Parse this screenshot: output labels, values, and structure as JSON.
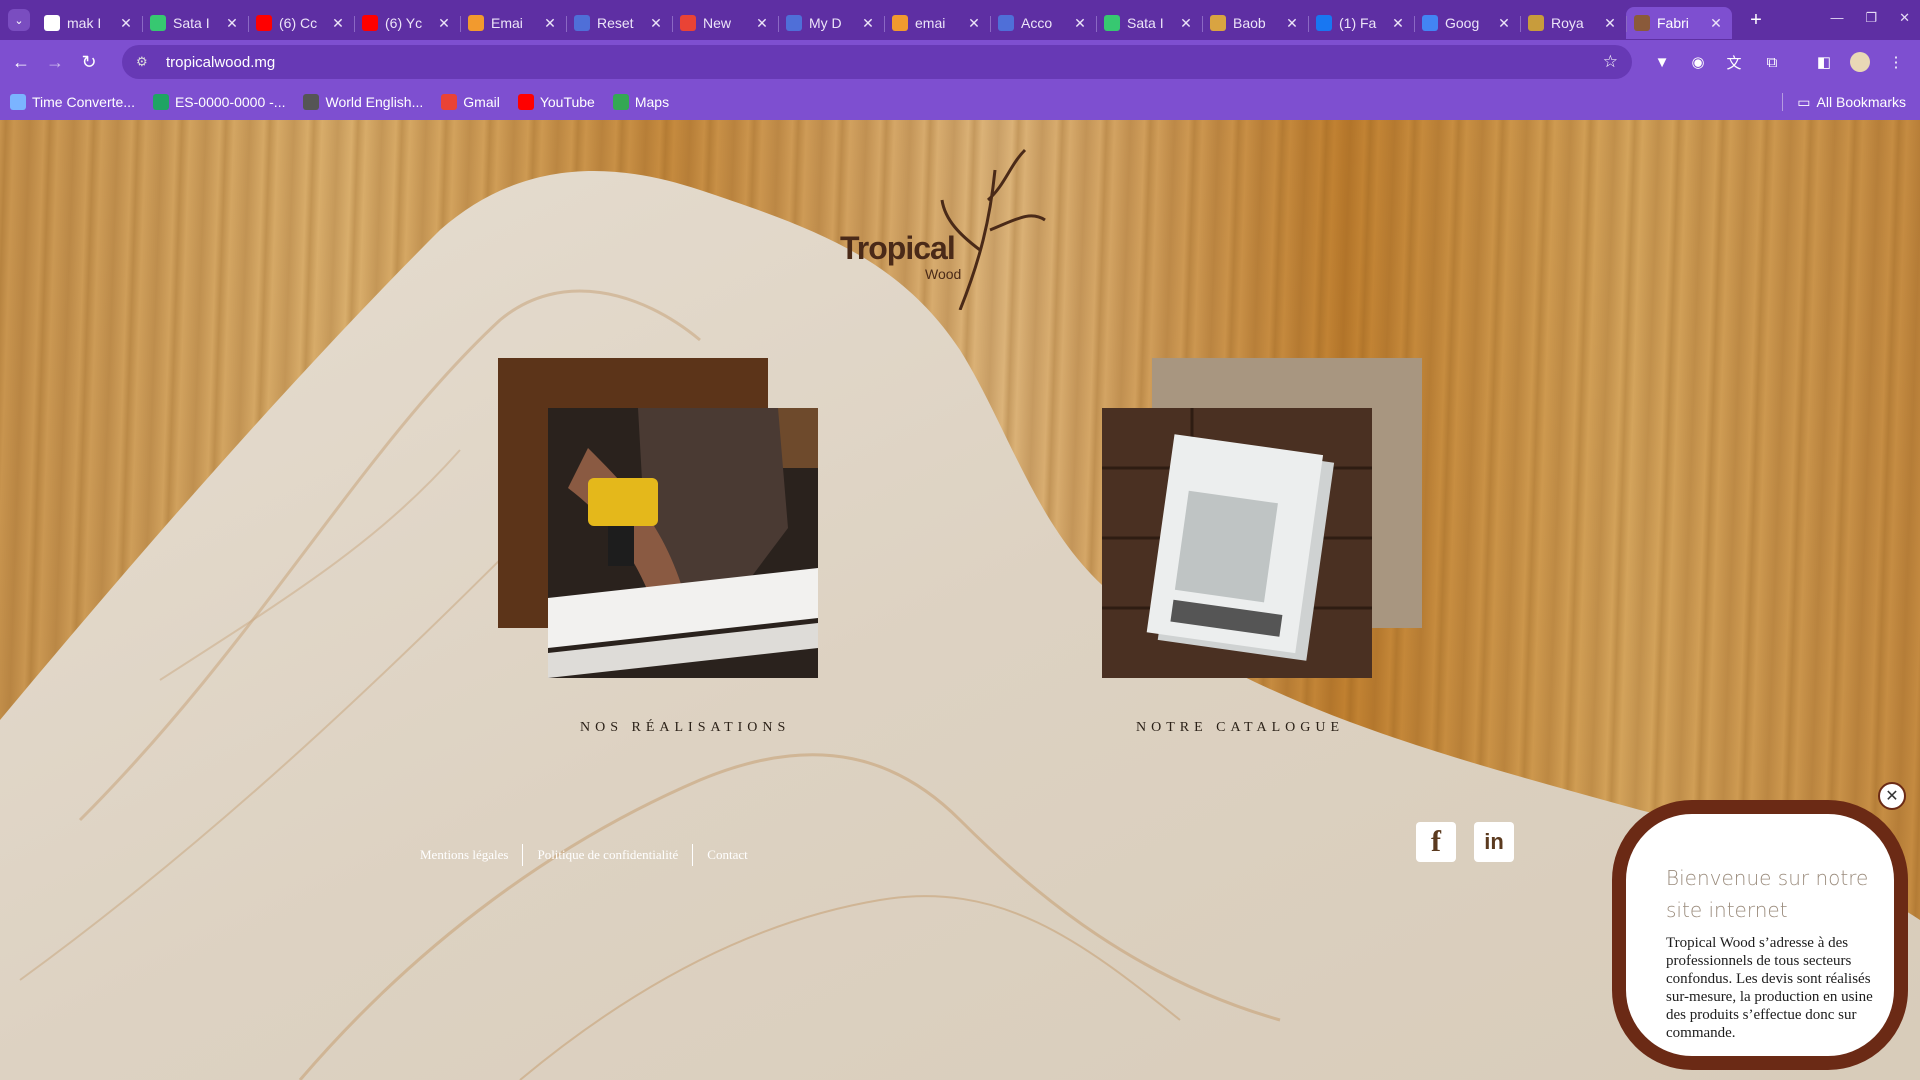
{
  "browser": {
    "tabs": [
      {
        "title": "mak I",
        "icon": "github-icon",
        "color": "#ffffff"
      },
      {
        "title": "Sata I",
        "icon": "v-icon",
        "color": "#37c871"
      },
      {
        "title": "(6) Cc",
        "icon": "youtube-icon",
        "color": "#ff0000"
      },
      {
        "title": "(6) Yc",
        "icon": "youtube-icon",
        "color": "#ff0000"
      },
      {
        "title": "Emai",
        "icon": "email-icon",
        "color": "#f29a2e"
      },
      {
        "title": "Reset",
        "icon": "shield-icon",
        "color": "#4f6fd8"
      },
      {
        "title": "New",
        "icon": "gmail-icon",
        "color": "#ea4335"
      },
      {
        "title": "My D",
        "icon": "shield-icon",
        "color": "#4f6fd8"
      },
      {
        "title": "emai",
        "icon": "email-icon",
        "color": "#f29a2e"
      },
      {
        "title": "Acco",
        "icon": "shield-icon",
        "color": "#4f6fd8"
      },
      {
        "title": "Sata I",
        "icon": "v-icon",
        "color": "#37c871"
      },
      {
        "title": "Baob",
        "icon": "baobab-icon",
        "color": "#d9a441"
      },
      {
        "title": "(1) Fa",
        "icon": "facebook-icon",
        "color": "#1877f2"
      },
      {
        "title": "Goog",
        "icon": "docs-icon",
        "color": "#4285f4"
      },
      {
        "title": "Roya",
        "icon": "royal-icon",
        "color": "#c89c3c"
      },
      {
        "title": "Fabri",
        "icon": "tropical-icon",
        "color": "#8a5a3a",
        "active": true
      }
    ],
    "url": "tropicalwood.mg",
    "bookmarks": [
      {
        "label": "Time Converte...",
        "icon": "clock-icon"
      },
      {
        "label": "ES-0000-0000 -...",
        "icon": "sheet-icon"
      },
      {
        "label": "World English...",
        "icon": "globe-icon"
      },
      {
        "label": "Gmail",
        "icon": "gmail-icon"
      },
      {
        "label": "YouTube",
        "icon": "youtube-icon"
      },
      {
        "label": "Maps",
        "icon": "maps-icon"
      }
    ],
    "all_bookmarks": "All Bookmarks"
  },
  "site": {
    "logo": {
      "main": "Tropical",
      "sub": "Wood"
    },
    "cards": [
      {
        "label": "NOS RÉALISATIONS",
        "back_color": "#5c3419"
      },
      {
        "label": "NOTRE CATALOGUE",
        "back_color": "#a89680"
      }
    ],
    "footer_links": [
      "Mentions légales",
      "Politique de confidentialité",
      "Contact"
    ],
    "social": [
      {
        "label": "f",
        "icon": "facebook-icon"
      },
      {
        "label": "in",
        "icon": "linkedin-icon"
      }
    ],
    "popup": {
      "close": "✕",
      "title": "Bienvenue sur notre site internet",
      "body": "Tropical Wood s’adresse à des professionnels de tous secteurs confondus. Les devis sont réalisés sur-mesure, la production en usine des produits s’effectue donc sur commande."
    }
  }
}
